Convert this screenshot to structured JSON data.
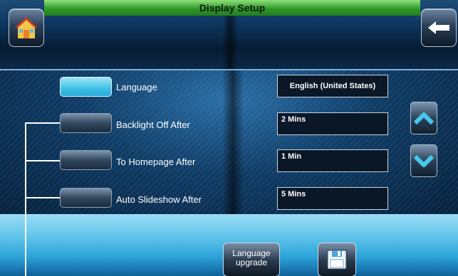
{
  "header": {
    "title": "Display Setup",
    "home_icon": "home-icon",
    "back_icon": "back-arrow-icon"
  },
  "settings": [
    {
      "label": "Language",
      "value": "English (United States)",
      "selected": true
    },
    {
      "label": "Backlight Off After",
      "value": "2 Mins",
      "selected": false
    },
    {
      "label": "To Homepage After",
      "value": "1 Min",
      "selected": false
    },
    {
      "label": "Auto Slideshow After",
      "value": "5 Mins",
      "selected": false
    }
  ],
  "scroll": {
    "up_icon": "chevron-up-icon",
    "down_icon": "chevron-down-icon"
  },
  "footer": {
    "language_upgrade_label": "Language upgrade",
    "save_icon": "floppy-disk-icon"
  },
  "colors": {
    "title_bar": "#2f9a2a",
    "selected_button": "#3cc0e6",
    "footer": "#63c6ec"
  }
}
